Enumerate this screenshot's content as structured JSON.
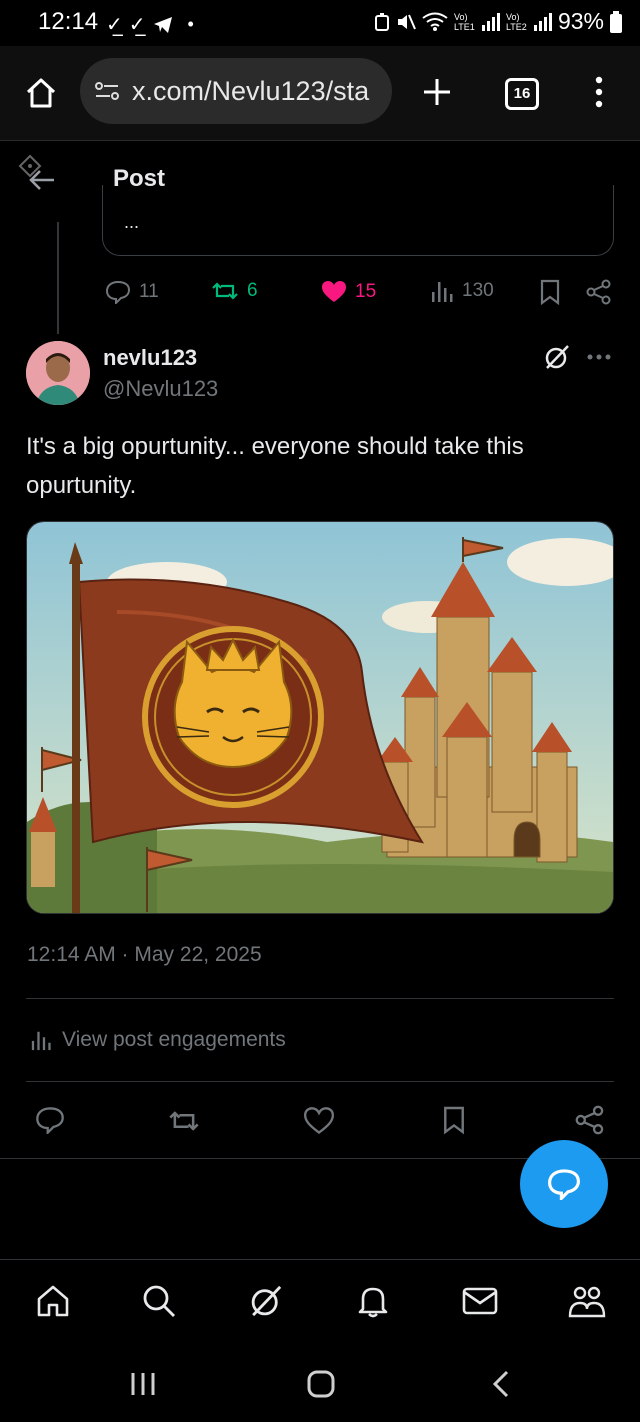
{
  "status_bar": {
    "time": "12:14",
    "battery": "93%",
    "signal_labels": [
      "Vo) LTE1",
      "Vo) LTE2"
    ]
  },
  "browser": {
    "url": "x.com/Nevlu123/sta",
    "tab_count": "16"
  },
  "header": {
    "title": "Post"
  },
  "quoted_post": {
    "ellipsis": "..."
  },
  "parent_metrics": {
    "replies": "11",
    "reposts": "6",
    "likes": "15",
    "views": "130"
  },
  "post": {
    "display_name": "nevlu123",
    "handle": "@Nevlu123",
    "text": "It's a big opurtunity... everyone should take this opurtunity.",
    "timestamp": "12:14 AM · May 22, 2025",
    "engagements_label": "View post engagements"
  },
  "colors": {
    "accent": "#1d9bf0",
    "like": "#f91880",
    "repost": "#00ba7c",
    "muted": "#71767b"
  },
  "icons": {
    "back": "arrow-left-icon",
    "grok": "grok-icon",
    "more": "more-icon",
    "reply": "reply-icon",
    "repost": "repost-icon",
    "like": "heart-icon",
    "views": "views-icon",
    "bookmark": "bookmark-icon",
    "share": "share-icon",
    "compose": "compose-icon"
  }
}
